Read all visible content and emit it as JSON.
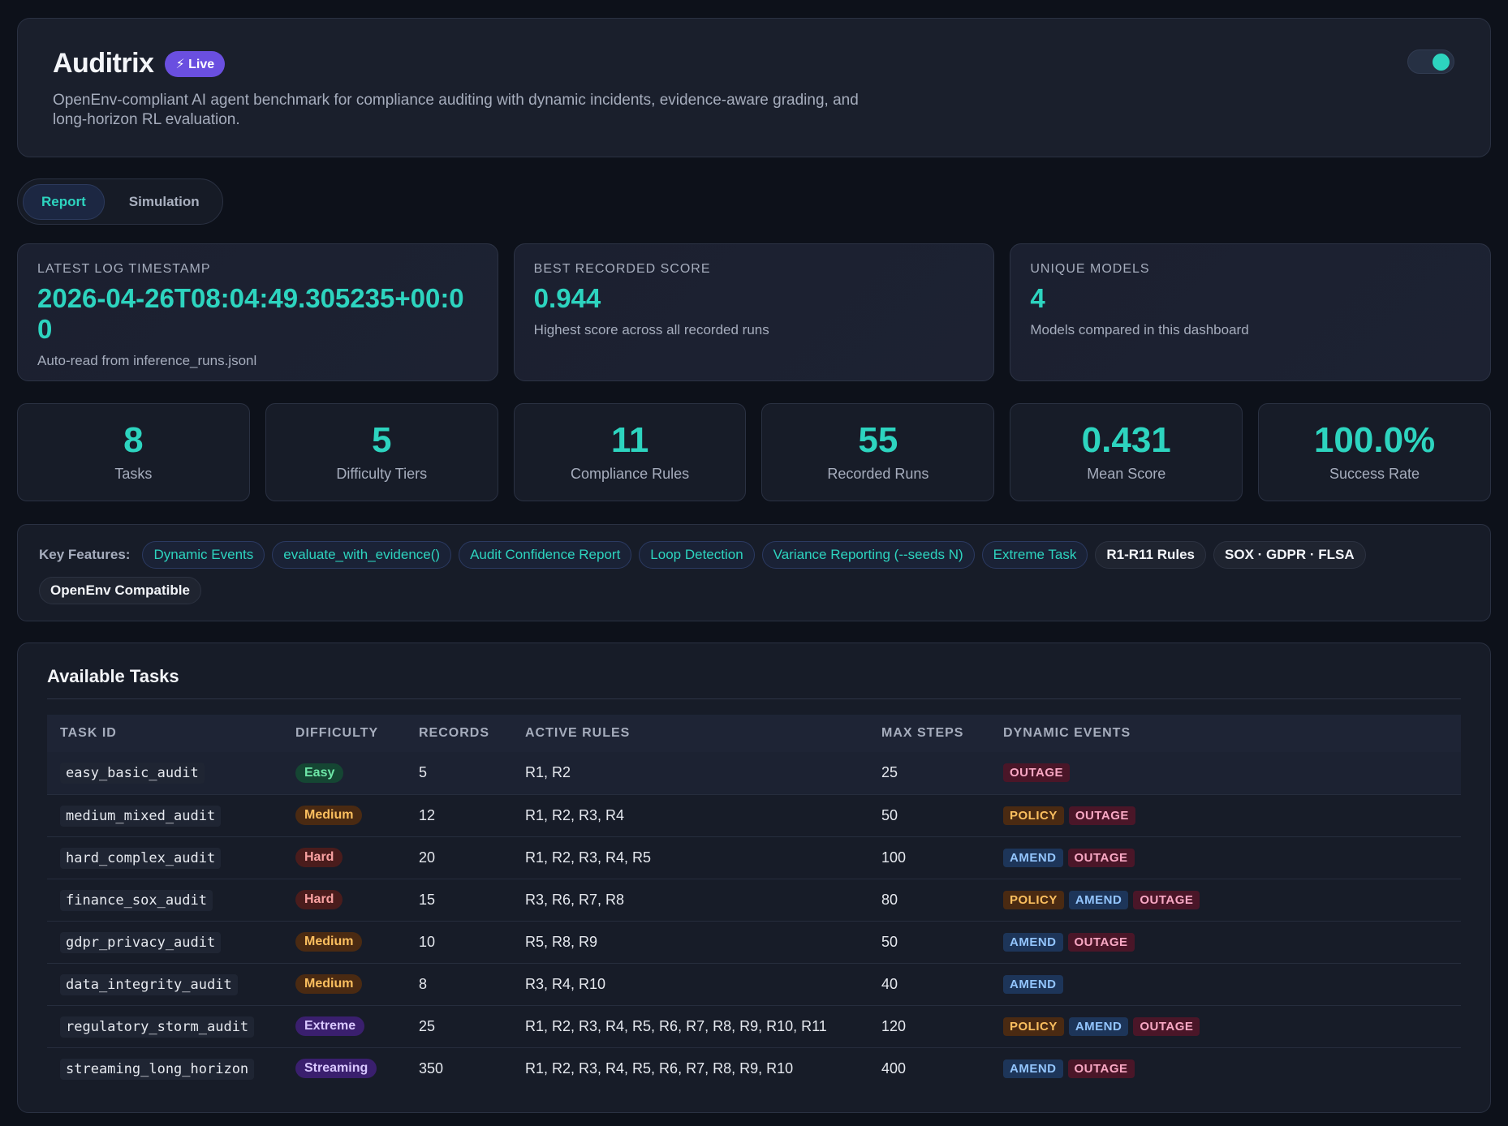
{
  "header": {
    "title": "Auditrix",
    "badge": "⚡ Live",
    "subtitle": "OpenEnv-compliant AI agent benchmark for compliance auditing with dynamic incidents, evidence-aware grading, and long-horizon RL evaluation."
  },
  "tabs": [
    {
      "label": "Report",
      "active": true
    },
    {
      "label": "Simulation",
      "active": false
    }
  ],
  "top_stats": [
    {
      "label": "LATEST LOG TIMESTAMP",
      "value": "2026-04-26T08:04:49.305235+00:00",
      "desc": "Auto-read from inference_runs.jsonl"
    },
    {
      "label": "BEST RECORDED SCORE",
      "value": "0.944",
      "desc": "Highest score across all recorded runs"
    },
    {
      "label": "UNIQUE MODELS",
      "value": "4",
      "desc": "Models compared in this dashboard"
    }
  ],
  "mini_stats": [
    {
      "value": "8",
      "label": "Tasks"
    },
    {
      "value": "5",
      "label": "Difficulty Tiers"
    },
    {
      "value": "11",
      "label": "Compliance Rules"
    },
    {
      "value": "55",
      "label": "Recorded Runs"
    },
    {
      "value": "0.431",
      "label": "Mean Score"
    },
    {
      "value": "100.0%",
      "label": "Success Rate"
    }
  ],
  "features": {
    "label": "Key Features:",
    "chips": [
      {
        "text": "Dynamic Events",
        "style": "accent"
      },
      {
        "text": "evaluate_with_evidence()",
        "style": "accent"
      },
      {
        "text": "Audit Confidence Report",
        "style": "accent"
      },
      {
        "text": "Loop Detection",
        "style": "accent"
      },
      {
        "text": "Variance Reporting (--seeds N)",
        "style": "accent"
      },
      {
        "text": "Extreme Task",
        "style": "accent"
      },
      {
        "text": "R1-R11 Rules",
        "style": "neutral"
      },
      {
        "text": "SOX · GDPR · FLSA",
        "style": "neutral"
      },
      {
        "text": "OpenEnv Compatible",
        "style": "neutral"
      }
    ]
  },
  "tasks": {
    "title": "Available Tasks",
    "columns": [
      "TASK ID",
      "DIFFICULTY",
      "RECORDS",
      "ACTIVE RULES",
      "MAX STEPS",
      "DYNAMIC EVENTS"
    ],
    "rows": [
      {
        "id": "easy_basic_audit",
        "difficulty": "Easy",
        "records": "5",
        "rules": "R1, R2",
        "max_steps": "25",
        "events": [
          "OUTAGE"
        ]
      },
      {
        "id": "medium_mixed_audit",
        "difficulty": "Medium",
        "records": "12",
        "rules": "R1, R2, R3, R4",
        "max_steps": "50",
        "events": [
          "POLICY",
          "OUTAGE"
        ]
      },
      {
        "id": "hard_complex_audit",
        "difficulty": "Hard",
        "records": "20",
        "rules": "R1, R2, R3, R4, R5",
        "max_steps": "100",
        "events": [
          "AMEND",
          "OUTAGE"
        ]
      },
      {
        "id": "finance_sox_audit",
        "difficulty": "Hard",
        "records": "15",
        "rules": "R3, R6, R7, R8",
        "max_steps": "80",
        "events": [
          "POLICY",
          "AMEND",
          "OUTAGE"
        ]
      },
      {
        "id": "gdpr_privacy_audit",
        "difficulty": "Medium",
        "records": "10",
        "rules": "R5, R8, R9",
        "max_steps": "50",
        "events": [
          "AMEND",
          "OUTAGE"
        ]
      },
      {
        "id": "data_integrity_audit",
        "difficulty": "Medium",
        "records": "8",
        "rules": "R3, R4, R10",
        "max_steps": "40",
        "events": [
          "AMEND"
        ]
      },
      {
        "id": "regulatory_storm_audit",
        "difficulty": "Extreme",
        "records": "25",
        "rules": "R1, R2, R3, R4, R5, R6, R7, R8, R9, R10, R11",
        "max_steps": "120",
        "events": [
          "POLICY",
          "AMEND",
          "OUTAGE"
        ]
      },
      {
        "id": "streaming_long_horizon",
        "difficulty": "Streaming",
        "records": "350",
        "rules": "R1, R2, R3, R4, R5, R6, R7, R8, R9, R10",
        "max_steps": "400",
        "events": [
          "AMEND",
          "OUTAGE"
        ]
      }
    ]
  }
}
